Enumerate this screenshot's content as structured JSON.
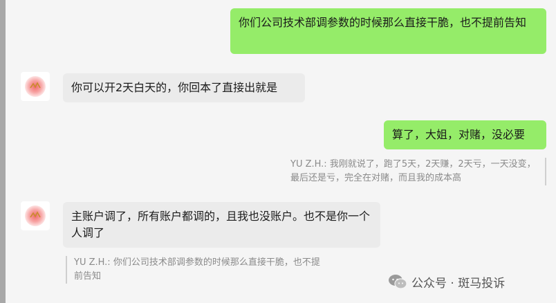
{
  "messages": [
    {
      "side": "right",
      "text": "你们公司技术部调参数的时候那么直接干脆，也不提前告知"
    },
    {
      "side": "left",
      "text": "你可以开2天白天的，你回本了直接出就是"
    },
    {
      "side": "right",
      "text": "算了，大姐，对赌，没必要",
      "quote": "YU Z.H.: 我刚就说了，跑了5天，2天赚，2天亏，一天没变，最后还是亏，完全在对赌，而且我的成本高"
    },
    {
      "side": "left",
      "text": "主账户调了，所有账户都调的，且我也没账户。也不是你一个人调了",
      "quote": "YU Z.H.: 你们公司技术部调参数的时候那么直接干脆，也不提前告知"
    }
  ],
  "watermark": {
    "text": "公众号 · 斑马投诉",
    "icon": "wechat-icon"
  },
  "colors": {
    "my_bubble": "#95ec69",
    "other_bubble": "#ebebeb",
    "background": "#f5f5f5"
  }
}
